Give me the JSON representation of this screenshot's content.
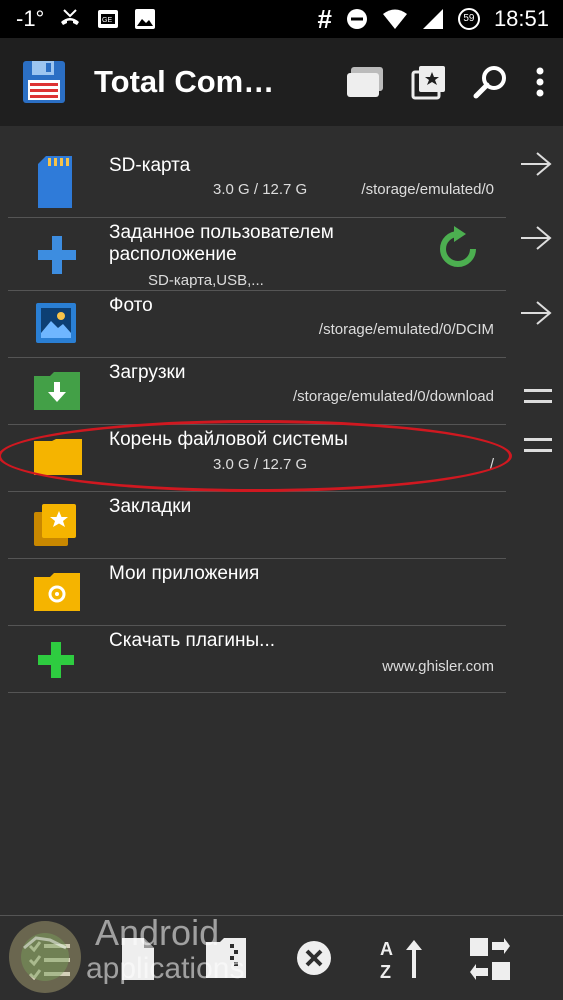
{
  "status_bar": {
    "signal_prefix": "-1°",
    "time": "18:51",
    "hash_symbol": "#",
    "battery_level": "59",
    "icons": [
      "missed-call-icon",
      "sim-card-icon",
      "image-icon",
      "hash-icon",
      "dnd-icon",
      "wifi-icon",
      "signal-icon",
      "battery-icon"
    ]
  },
  "app_bar": {
    "title": "Total Com…",
    "icons": [
      "floppy-disk-icon",
      "folders-icon",
      "bookmark-star-icon",
      "search-icon",
      "more-vert-icon"
    ]
  },
  "list": [
    {
      "label": "SD-карта",
      "detail": "3.0 G / 12.7 G",
      "path": "/storage/emulated/0",
      "icon": "sd-card-icon",
      "side": "arrow-right-icon"
    },
    {
      "label": "Заданное пользователем расположение",
      "detail": "SD-карта,USB,...",
      "path": "",
      "icon": "plus-blue-icon",
      "side": "arrow-right-icon",
      "extra_icon": "refresh-green-icon"
    },
    {
      "label": "Фото",
      "detail": "",
      "path": "/storage/emulated/0/DCIM",
      "icon": "photo-icon",
      "side": "arrow-right-icon"
    },
    {
      "label": "Загрузки",
      "detail": "",
      "path": "/storage/emulated/0/download",
      "icon": "download-folder-icon",
      "side": "drag-handle-icon"
    },
    {
      "label": "Корень файловой системы",
      "detail": "3.0 G / 12.7 G",
      "path": "/",
      "icon": "folder-icon",
      "side": "drag-handle-icon"
    },
    {
      "label": "Закладки",
      "detail": "",
      "path": "",
      "icon": "bookmarks-icon",
      "side": ""
    },
    {
      "label": "Мои приложения",
      "detail": "",
      "path": "",
      "icon": "apps-folder-icon",
      "side": ""
    },
    {
      "label": "Скачать плагины...",
      "detail": "",
      "path": "www.ghisler.com",
      "icon": "plus-green-icon",
      "side": ""
    }
  ],
  "bottom_bar": {
    "icons": [
      "select-icon",
      "file-icon",
      "zip-icon",
      "close-circle-icon",
      "sort-az-icon",
      "swap-icon"
    ]
  },
  "watermark": {
    "line1": "Android",
    "line2": "applications"
  },
  "colors": {
    "accent_red": "#d01820",
    "refresh_green": "#4caf50",
    "plus_blue": "#3d8de0",
    "folder_yellow": "#f5b400",
    "download_green": "#43a047"
  }
}
